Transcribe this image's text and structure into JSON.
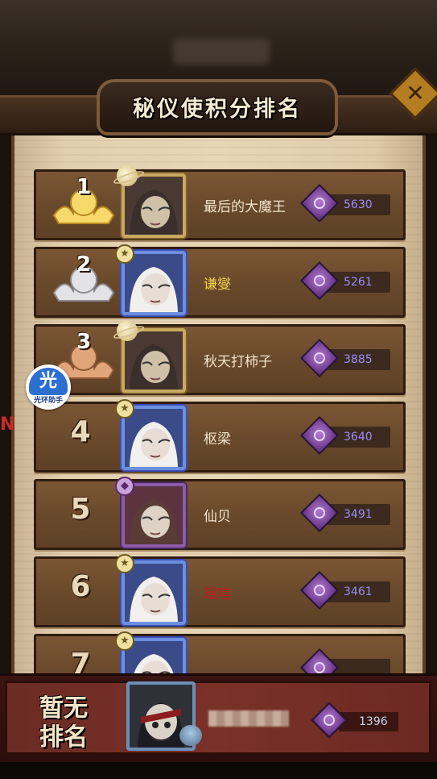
{
  "header": {
    "title": "秘仪使积分排名"
  },
  "close_button": {
    "icon": "close-x-icon"
  },
  "helper": {
    "glyph": "光",
    "label": "光环助手"
  },
  "side_marker": "N",
  "rankings": [
    {
      "rank": "1",
      "medal": "gold",
      "name": "最后的大魔王",
      "name_color": "default",
      "score": "5630",
      "frame": "gold",
      "badge": "planet"
    },
    {
      "rank": "2",
      "medal": "silver",
      "name": "谦燮",
      "name_color": "yellow",
      "score": "5261",
      "frame": "blue",
      "badge": "star"
    },
    {
      "rank": "3",
      "medal": "bronze",
      "name": "秋天打柿子",
      "name_color": "default",
      "score": "3885",
      "frame": "gold",
      "badge": "planet"
    },
    {
      "rank": "4",
      "medal": "none",
      "name": "枢梁",
      "name_color": "default",
      "score": "3640",
      "frame": "blue",
      "badge": "star"
    },
    {
      "rank": "5",
      "medal": "none",
      "name": "仙贝",
      "name_color": "default",
      "score": "3491",
      "frame": "purple",
      "badge": "diamond"
    },
    {
      "rank": "6",
      "medal": "none",
      "name": "瑶唁",
      "name_color": "red",
      "score": "3461",
      "frame": "blue",
      "badge": "star"
    },
    {
      "rank": "7",
      "medal": "none",
      "name": "",
      "name_color": "red",
      "score": "",
      "frame": "blue",
      "badge": "star"
    }
  ],
  "self": {
    "rank_label_line1": "暂无",
    "rank_label_line2": "排名",
    "score": "1396"
  },
  "colors": {
    "panel": "#e2cfae",
    "row": "#6a4a2c",
    "score_text": "#9b8cff",
    "self_bar": "#7a3128"
  }
}
